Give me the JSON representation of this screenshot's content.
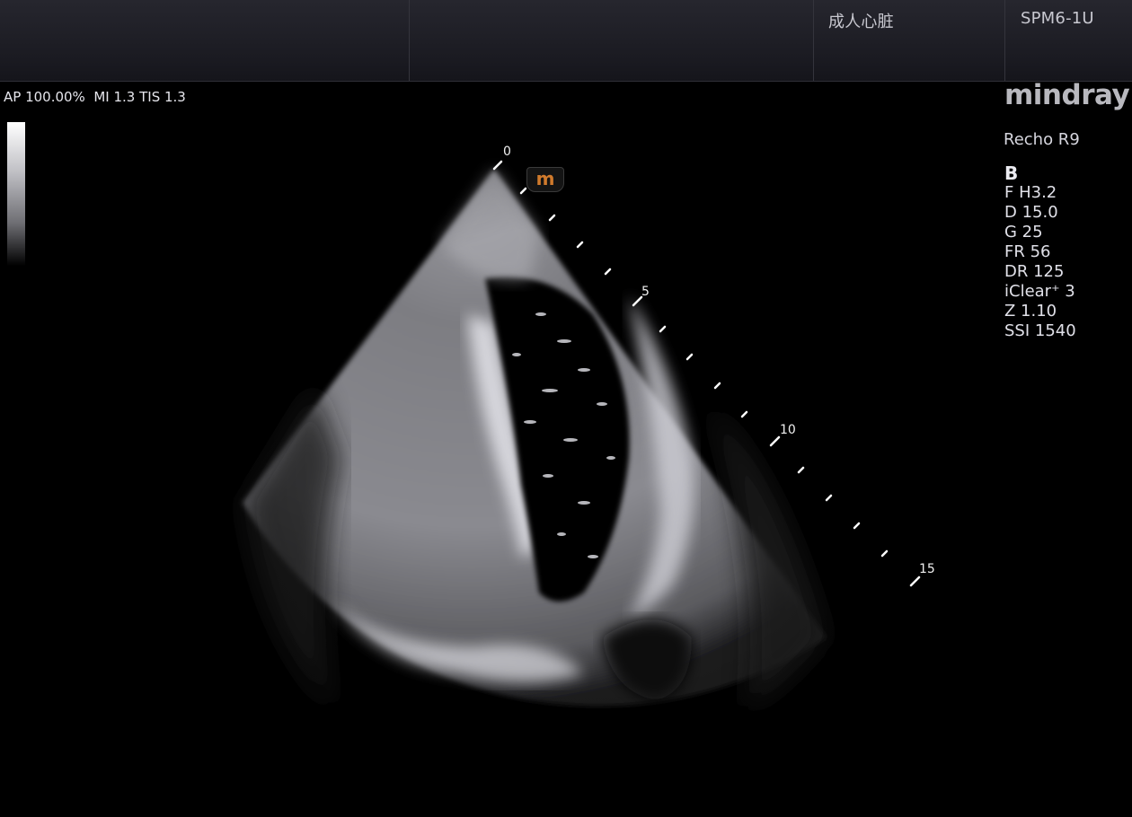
{
  "header": {
    "preset": "成人心脏",
    "probe": "SPM6-1U"
  },
  "acoustic": {
    "text": "AP 100.00%  MI 1.3 TIS 1.3"
  },
  "brand": {
    "logo": "mindray",
    "model": "Recho R9"
  },
  "imaging": {
    "mode": "B",
    "params": [
      "F H3.2",
      "D 15.0",
      "G 25",
      "FR 56",
      "DR 125",
      "iClear⁺ 3",
      "Z 1.10",
      "SSI 1540"
    ]
  },
  "orientation_marker": "m",
  "depth_scale": {
    "labels": [
      "0",
      "5",
      "10",
      "15"
    ]
  },
  "colors": {
    "accent_marker": "#d07a2c",
    "topbar": "#1e1e26"
  }
}
